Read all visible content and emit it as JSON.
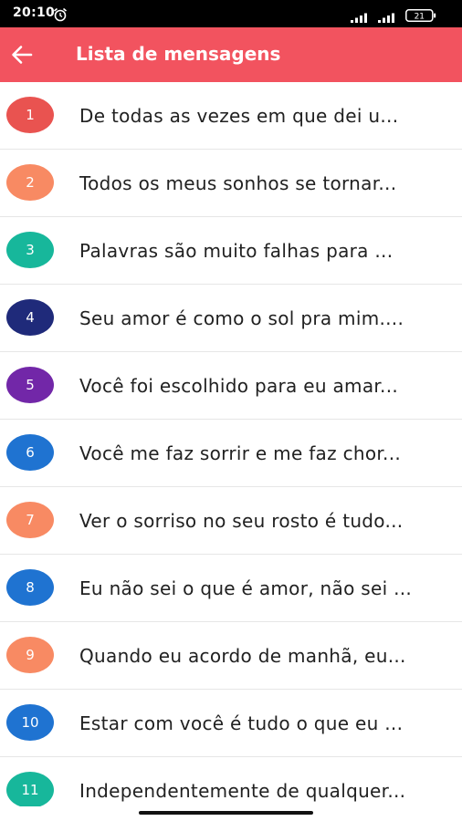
{
  "status_bar": {
    "time": "20:10",
    "battery": "21"
  },
  "app_bar": {
    "title": "Lista de mensagens",
    "back_icon": "arrow-left-icon"
  },
  "colors": {
    "app_bar": "#f2535f",
    "red": "#e95350",
    "orange": "#f88a63",
    "teal": "#17b79b",
    "navy": "#1f2a7a",
    "purple": "#7227a8",
    "blue": "#1f73d1"
  },
  "messages": [
    {
      "number": "1",
      "text": "De todas as vezes em que dei u...",
      "color": "#e95350"
    },
    {
      "number": "2",
      "text": "Todos os meus sonhos se tornar...",
      "color": "#f88a63"
    },
    {
      "number": "3",
      "text": "Palavras são muito falhas para ...",
      "color": "#17b79b"
    },
    {
      "number": "4",
      "text": "Seu amor é como o sol pra mim....",
      "color": "#1f2a7a"
    },
    {
      "number": "5",
      "text": "Você foi escolhido para eu amar...",
      "color": "#7227a8"
    },
    {
      "number": "6",
      "text": "Você me faz sorrir e me faz chor...",
      "color": "#1f73d1"
    },
    {
      "number": "7",
      "text": "Ver o sorriso no seu rosto é tudo...",
      "color": "#f88a63"
    },
    {
      "number": "8",
      "text": "Eu não sei o que é amor, não sei ...",
      "color": "#1f73d1"
    },
    {
      "number": "9",
      "text": "Quando eu acordo de manhã, eu...",
      "color": "#f88a63"
    },
    {
      "number": "10",
      "text": "Estar com você é tudo o que eu ...",
      "color": "#1f73d1"
    },
    {
      "number": "11",
      "text": "Independentemente de qualquer...",
      "color": "#17b79b"
    }
  ]
}
